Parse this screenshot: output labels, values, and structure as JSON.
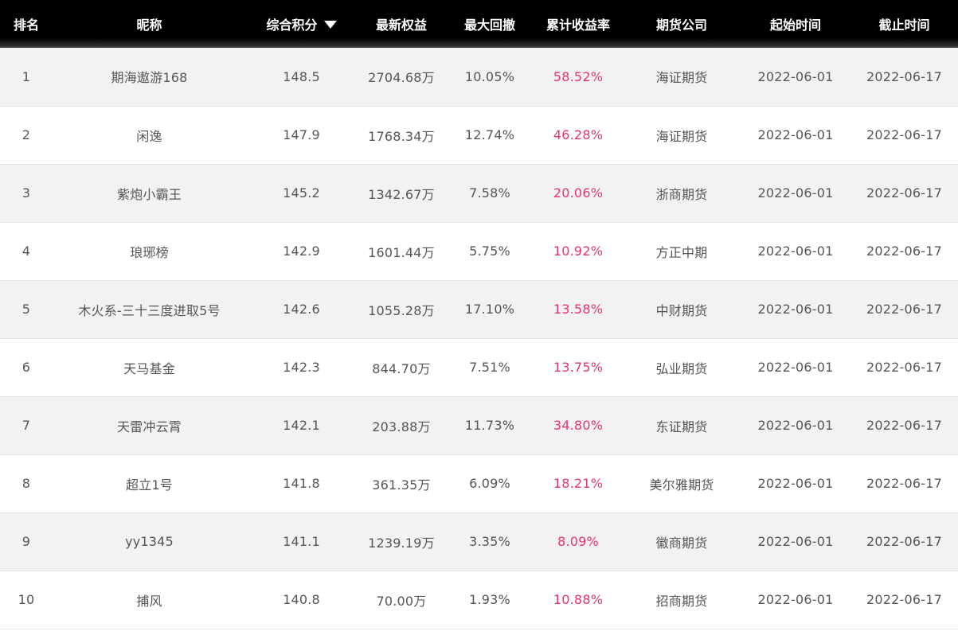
{
  "columns": {
    "rank": "排名",
    "nickname": "昵称",
    "score": "综合积分",
    "equity": "最新权益",
    "drawdown": "最大回撤",
    "return": "累计收益率",
    "company": "期货公司",
    "start": "起始时间",
    "end": "截止时间"
  },
  "rows": [
    {
      "rank": "1",
      "nickname": "期海遨游168",
      "score": "148.5",
      "equity": "2704.68万",
      "drawdown": "10.05%",
      "return": "58.52%",
      "company": "海证期货",
      "start": "2022-06-01",
      "end": "2022-06-17"
    },
    {
      "rank": "2",
      "nickname": "闲逸",
      "score": "147.9",
      "equity": "1768.34万",
      "drawdown": "12.74%",
      "return": "46.28%",
      "company": "海证期货",
      "start": "2022-06-01",
      "end": "2022-06-17"
    },
    {
      "rank": "3",
      "nickname": "紫炮小霸王",
      "score": "145.2",
      "equity": "1342.67万",
      "drawdown": "7.58%",
      "return": "20.06%",
      "company": "浙商期货",
      "start": "2022-06-01",
      "end": "2022-06-17"
    },
    {
      "rank": "4",
      "nickname": "琅琊榜",
      "score": "142.9",
      "equity": "1601.44万",
      "drawdown": "5.75%",
      "return": "10.92%",
      "company": "方正中期",
      "start": "2022-06-01",
      "end": "2022-06-17"
    },
    {
      "rank": "5",
      "nickname": "木火系-三十三度进取5号",
      "score": "142.6",
      "equity": "1055.28万",
      "drawdown": "17.10%",
      "return": "13.58%",
      "company": "中财期货",
      "start": "2022-06-01",
      "end": "2022-06-17"
    },
    {
      "rank": "6",
      "nickname": "天马基金",
      "score": "142.3",
      "equity": "844.70万",
      "drawdown": "7.51%",
      "return": "13.75%",
      "company": "弘业期货",
      "start": "2022-06-01",
      "end": "2022-06-17"
    },
    {
      "rank": "7",
      "nickname": "天雷冲云霄",
      "score": "142.1",
      "equity": "203.88万",
      "drawdown": "11.73%",
      "return": "34.80%",
      "company": "东证期货",
      "start": "2022-06-01",
      "end": "2022-06-17"
    },
    {
      "rank": "8",
      "nickname": "超立1号",
      "score": "141.8",
      "equity": "361.35万",
      "drawdown": "6.09%",
      "return": "18.21%",
      "company": "美尔雅期货",
      "start": "2022-06-01",
      "end": "2022-06-17"
    },
    {
      "rank": "9",
      "nickname": "yy1345",
      "score": "141.1",
      "equity": "1239.19万",
      "drawdown": "3.35%",
      "return": "8.09%",
      "company": "徽商期货",
      "start": "2022-06-01",
      "end": "2022-06-17"
    },
    {
      "rank": "10",
      "nickname": "捕风",
      "score": "140.8",
      "equity": "70.00万",
      "drawdown": "1.93%",
      "return": "10.88%",
      "company": "招商期货",
      "start": "2022-06-01",
      "end": "2022-06-17"
    }
  ],
  "icons": {
    "sort": "sort-descending-icon"
  },
  "colors": {
    "header_bg": "#000000",
    "header_text": "#ffffff",
    "row_alt": "#f2f2f2",
    "text": "#555555",
    "return_text": "#e8336b"
  }
}
